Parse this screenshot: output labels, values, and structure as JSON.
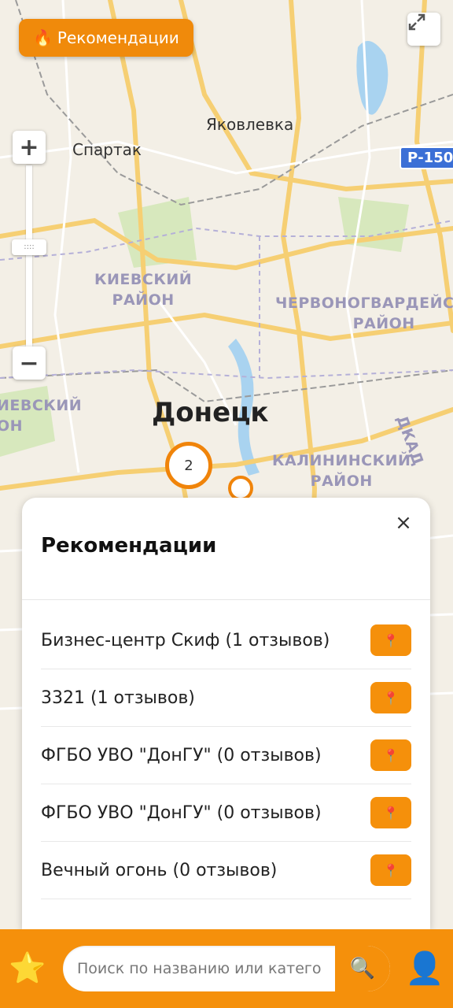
{
  "map": {
    "labels": {
      "spartak": "Спартак",
      "yakovlevka": "Яковлевка",
      "donetsk": "Донецк",
      "kievsky": "КИЕВСКИЙ\nРАЙОН",
      "chervonogvard": "ЧЕРВОНОГВАРДЕЙСКИЙ\nРАЙОН",
      "kalininsky": "КАЛИНИНСКИЙ\nРАЙОН",
      "kievsky_edge": "ИЕВСКИЙ\nОН",
      "dkad": "ДКАД"
    },
    "road_shield": "Р-150",
    "cluster_count": "2",
    "zoom_handle": "::::",
    "zoom_in": "+",
    "zoom_out": "−",
    "colors": {
      "accent": "#f5900b",
      "road": "#f7d27a",
      "water": "#9ac9ea",
      "park": "#cfe5b0"
    }
  },
  "recommendations_toggle": {
    "icon": "🔥",
    "label": "Рекомендации"
  },
  "panel": {
    "title": "Рекомендации",
    "close": "×",
    "items": [
      {
        "name": "Бизнес-центр Скиф (1 отзывов)",
        "pin_icon": "📍"
      },
      {
        "name": "3321 (1 отзывов)",
        "pin_icon": "📍"
      },
      {
        "name": "ФГБО УВО \"ДонГУ\" (0 отзывов)",
        "pin_icon": "📍"
      },
      {
        "name": "ФГБО УВО \"ДонГУ\" (0 отзывов)",
        "pin_icon": "📍"
      },
      {
        "name": "Вечный огонь (0 отзывов)",
        "pin_icon": "📍"
      }
    ]
  },
  "bottom_bar": {
    "favorites_icon": "⭐",
    "search_placeholder": "Поиск по названию или катего",
    "search_icon": "🔍",
    "profile_icon": "👤"
  }
}
